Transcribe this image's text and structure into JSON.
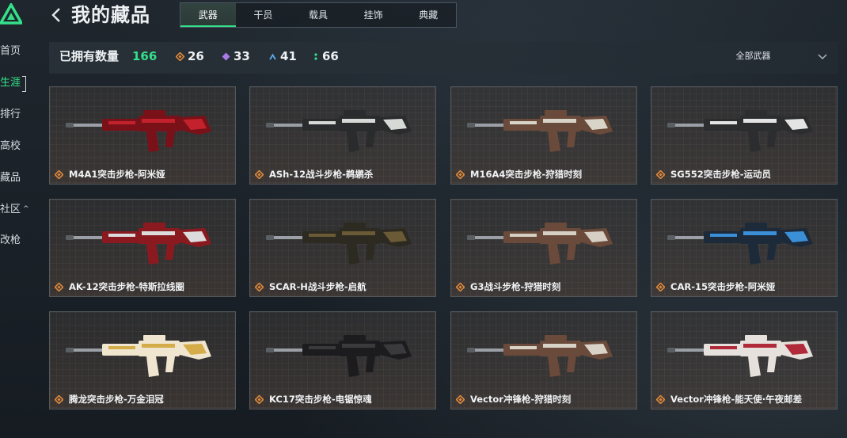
{
  "sidebar": {
    "items": [
      {
        "label": "首页",
        "active": false
      },
      {
        "label": "生涯",
        "active": true
      },
      {
        "label": "排行",
        "active": false
      },
      {
        "label": "高校",
        "active": false
      },
      {
        "label": "藏品",
        "active": false
      },
      {
        "label": "社区",
        "active": false
      },
      {
        "label": "改枪",
        "active": false
      }
    ]
  },
  "header": {
    "title": "我的藏品",
    "tabs": [
      "武器",
      "干员",
      "载具",
      "挂饰",
      "典藏"
    ],
    "active_tab": "武器"
  },
  "stats": {
    "owned_label": "已拥有数量",
    "owned_count": "166",
    "gold": "26",
    "purple": "33",
    "blue": "41",
    "green": "66",
    "filter_label": "全部武器"
  },
  "colors": {
    "accent_green": "#35e08a",
    "gold": "#e0893a",
    "purple": "#a77ae6",
    "blue": "#5aa8e6"
  },
  "weapons": [
    {
      "name": "M4A1突击步枪-阿米娅",
      "accent": "#c3222d",
      "body": "#7a1118"
    },
    {
      "name": "ASh-12战斗步枪-鹈鹕杀",
      "accent": "#d7d9d6",
      "body": "#2a2b2c"
    },
    {
      "name": "M16A4突击步枪-狩猎时刻",
      "accent": "#d9d4c8",
      "body": "#6a4a3a"
    },
    {
      "name": "SG552突击步枪-运动员",
      "accent": "#e4e4e4",
      "body": "#2b2d2f"
    },
    {
      "name": "AK-12突击步枪-特斯拉线圈",
      "accent": "#dcdcdc",
      "body": "#8a1a20"
    },
    {
      "name": "SCAR-H战斗步枪-启航",
      "accent": "#6a5a35",
      "body": "#2d2a22"
    },
    {
      "name": "G3战斗步枪-狩猎时刻",
      "accent": "#d5cfc4",
      "body": "#6a4a3a"
    },
    {
      "name": "CAR-15突击步枪-阿米娅",
      "accent": "#3b8fd6",
      "body": "#1d2a3a"
    },
    {
      "name": "腾龙突击步枪-万金泪冠",
      "accent": "#d4ad4a",
      "body": "#f0e6cf"
    },
    {
      "name": "KC17突击步枪-电锯惊魂",
      "accent": "#3a3a3c",
      "body": "#1c1c1e"
    },
    {
      "name": "Vector冲锋枪-狩猎时刻",
      "accent": "#d9d2c6",
      "body": "#6a4a3a"
    },
    {
      "name": "Vector冲锋枪-能天使·午夜邮差",
      "accent": "#b02a3a",
      "body": "#e6e1dc"
    }
  ]
}
